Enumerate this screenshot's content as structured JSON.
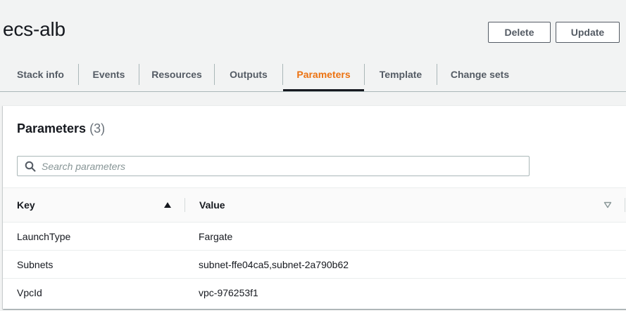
{
  "stack": {
    "name": "ecs-alb"
  },
  "actions": {
    "delete_label": "Delete",
    "update_label": "Update"
  },
  "tabs": [
    {
      "label": "Stack info"
    },
    {
      "label": "Events"
    },
    {
      "label": "Resources"
    },
    {
      "label": "Outputs"
    },
    {
      "label": "Parameters",
      "active": true
    },
    {
      "label": "Template"
    },
    {
      "label": "Change sets"
    }
  ],
  "parameters": {
    "title": "Parameters",
    "count": "(3)",
    "search_placeholder": "Search parameters",
    "columns": {
      "key": "Key",
      "value": "Value"
    },
    "rows": [
      {
        "key": "LaunchType",
        "value": "Fargate"
      },
      {
        "key": "Subnets",
        "value": "subnet-ffe04ca5,subnet-2a790b62"
      },
      {
        "key": "VpcId",
        "value": "vpc-976253f1"
      }
    ]
  },
  "colors": {
    "accent": "#ec7211",
    "text": "#16191f",
    "muted": "#545b64",
    "background": "#f2f3f3"
  },
  "icons": {
    "search": "search-icon",
    "sort_ascending": "caret-up-icon",
    "sort_unsorted": "caret-down-outline-icon"
  }
}
